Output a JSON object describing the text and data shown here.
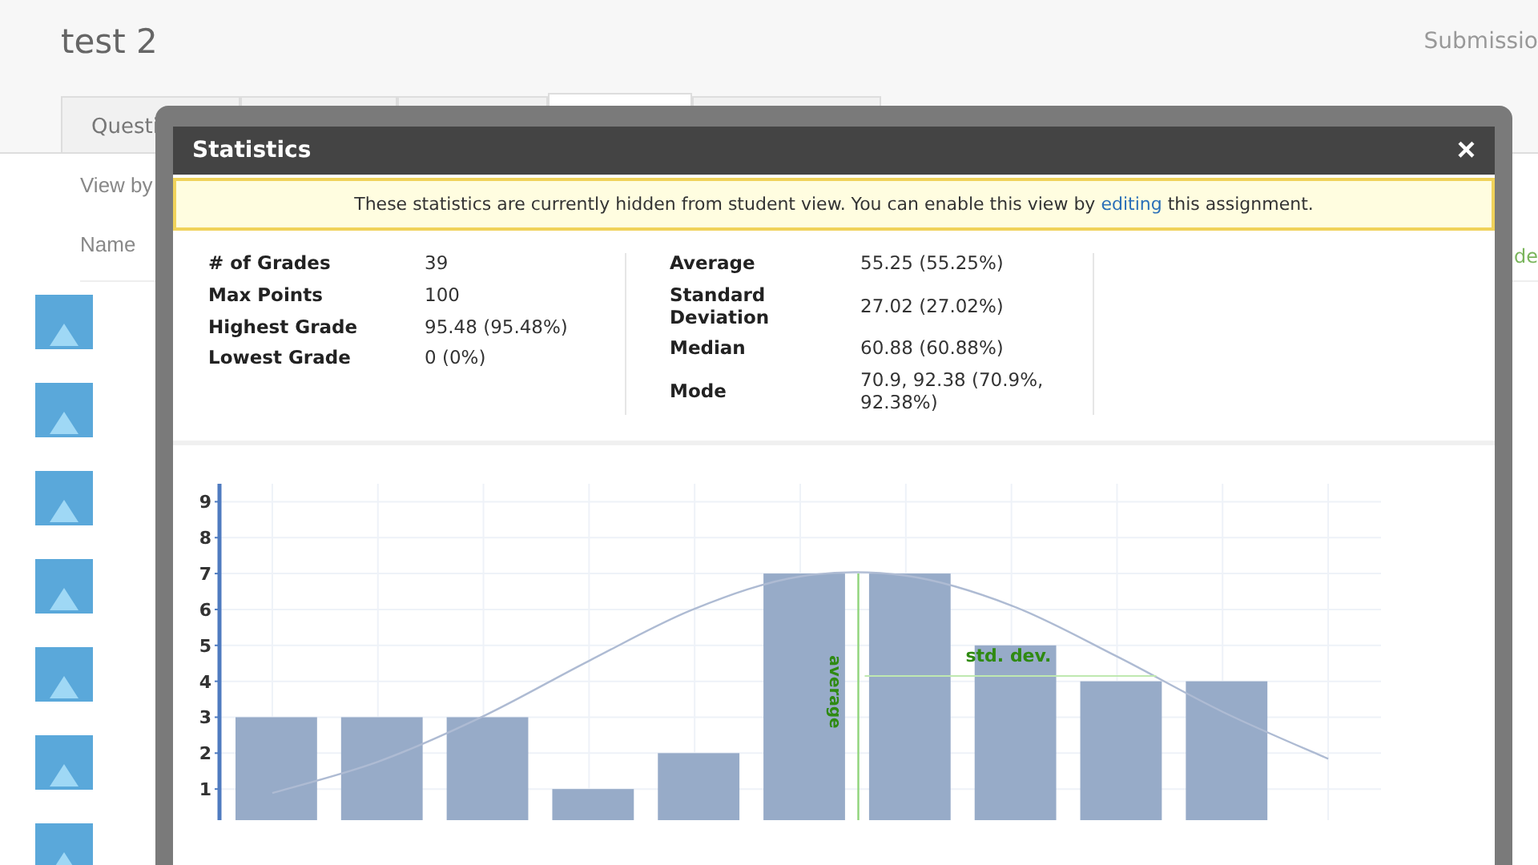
{
  "page": {
    "title": "test 2",
    "submissions_link": "Submissio",
    "view_by": "View by",
    "name_column": "Name",
    "grade_column": "de"
  },
  "tabs": [
    {
      "label": "Questi",
      "selected": false
    },
    {
      "selected": false
    },
    {
      "selected": false
    },
    {
      "selected": true
    },
    {
      "selected": false
    }
  ],
  "dialog": {
    "title": "Statistics",
    "close": "×",
    "notice": {
      "before": "These statistics are currently hidden from student view. You can enable this view by",
      "link": "editing",
      "after": "this assignment."
    },
    "stats_left": [
      {
        "label": "# of Grades",
        "value": "39"
      },
      {
        "label": "Max Points",
        "value": "100"
      },
      {
        "label": "Highest Grade",
        "value": "95.48 (95.48%)"
      },
      {
        "label": "Lowest Grade",
        "value": "0 (0%)"
      }
    ],
    "stats_right": [
      {
        "label": "Average",
        "value": "55.25 (55.25%)"
      },
      {
        "label": "Standard Deviation",
        "value": "27.02 (27.02%)"
      },
      {
        "label": "Median",
        "value": "60.88 (60.88%)"
      },
      {
        "label": "Mode",
        "value": "70.9, 92.38 (70.9%, 92.38%)"
      }
    ],
    "chart_data": {
      "type": "bar",
      "series": [
        {
          "type": "bar",
          "color": "#97abc8",
          "values": [
            3,
            3,
            3,
            1,
            2,
            7,
            7,
            5,
            4,
            4,
            null
          ]
        },
        {
          "type": "line",
          "color": "#aebbd3",
          "values": [
            0.89,
            1.76,
            3.03,
            4.57,
            6.02,
            6.92,
            6.94,
            6.11,
            4.69,
            3.15,
            1.84
          ]
        }
      ],
      "ylim": [
        0,
        9.5
      ],
      "grid": true,
      "yticks": [
        1,
        2,
        3,
        4,
        5,
        6,
        7,
        8,
        9
      ],
      "annotations": [
        "average"
      ],
      "ref_lines": [
        {
          "axis": "y",
          "value": 4.15,
          "label": "std. dev."
        }
      ]
    }
  }
}
